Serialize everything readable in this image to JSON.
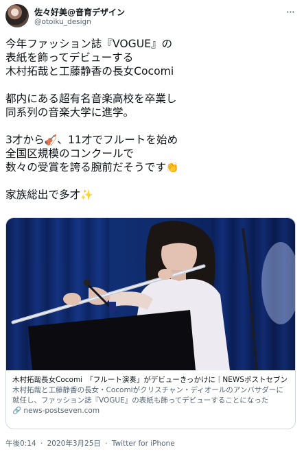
{
  "author": {
    "display_name": "佐々好美@音育デザイン",
    "handle": "@otoiku_design"
  },
  "tweet": {
    "lines": [
      "今年ファッション誌『VOGUE』の",
      "表紙を飾ってデビューする",
      "木村拓哉と工藤静香の長女Cocomi",
      "",
      "都内にある超有名音楽高校を卒業し",
      "同系列の音楽大学に進学。",
      "",
      "3才から",
      "全国区規模のコンクールで",
      "数々の受賞を誇る腕前だそうです",
      "",
      "家族総出で多才"
    ],
    "line8_suffix": "、11才でフルートを始め",
    "emoji_violin": "🎻",
    "emoji_clap": "👏",
    "emoji_sparkles": "✨"
  },
  "card": {
    "title": "木村拓哉長女Cocomi　「フルート演奏」がデビューきっかけに｜NEWSポストセブン",
    "description": "木村拓哉と工藤静香の長女・Cocomiがクリスチャン・ディオールのアンバサダーに就任し、ファッション誌『VOGUE』の表紙も飾ってデビューすることになった",
    "domain": "news-postseven.com",
    "link_icon": "link-icon"
  },
  "meta": {
    "time": "午後0:14",
    "date": "2020年3月25日",
    "separator": "·",
    "source": "Twitter for iPhone"
  },
  "colors": {
    "text_primary": "#0f1419",
    "text_secondary": "#536471",
    "border": "#cfd9de",
    "stage_blue": "#10307a"
  }
}
